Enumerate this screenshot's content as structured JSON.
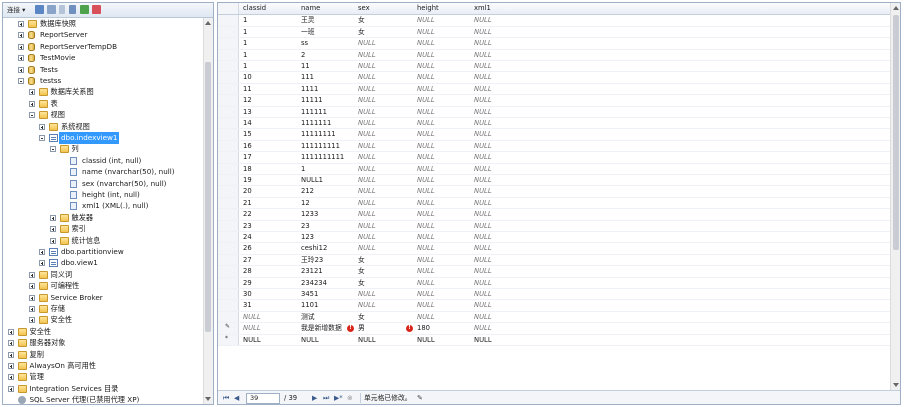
{
  "object_explorer": {
    "toolbar": {
      "connect_label": "连接 ▾"
    },
    "tree": [
      {
        "label": "数据库快照",
        "icon": "folder",
        "exp": "plus",
        "indent": 2
      },
      {
        "label": "ReportServer",
        "icon": "db",
        "exp": "plus",
        "indent": 2
      },
      {
        "label": "ReportServerTempDB",
        "icon": "db",
        "exp": "plus",
        "indent": 2
      },
      {
        "label": "TestMovie",
        "icon": "db",
        "exp": "plus",
        "indent": 2
      },
      {
        "label": "Tests",
        "icon": "db",
        "exp": "plus",
        "indent": 2
      },
      {
        "label": "testss",
        "icon": "db",
        "exp": "minus",
        "indent": 2
      },
      {
        "label": "数据库关系图",
        "icon": "folder",
        "exp": "plus",
        "indent": 3
      },
      {
        "label": "表",
        "icon": "folder",
        "exp": "plus",
        "indent": 3
      },
      {
        "label": "视图",
        "icon": "folder",
        "exp": "minus",
        "indent": 3
      },
      {
        "label": "系统视图",
        "icon": "folder",
        "exp": "plus",
        "indent": 4
      },
      {
        "label": "dbo.indexview1",
        "icon": "view",
        "exp": "minus",
        "indent": 4,
        "selected": true
      },
      {
        "label": "列",
        "icon": "folder",
        "exp": "minus",
        "indent": 5
      },
      {
        "label": "classid (int, null)",
        "icon": "col",
        "exp": "",
        "indent": 6
      },
      {
        "label": "name (nvarchar(50), null)",
        "icon": "col",
        "exp": "",
        "indent": 6
      },
      {
        "label": "sex (nvarchar(50), null)",
        "icon": "col",
        "exp": "",
        "indent": 6
      },
      {
        "label": "height (int, null)",
        "icon": "col",
        "exp": "",
        "indent": 6
      },
      {
        "label": "xml1 (XML(.), null)",
        "icon": "col",
        "exp": "",
        "indent": 6
      },
      {
        "label": "触发器",
        "icon": "folder",
        "exp": "plus",
        "indent": 5
      },
      {
        "label": "索引",
        "icon": "folder",
        "exp": "plus",
        "indent": 5
      },
      {
        "label": "统计信息",
        "icon": "folder",
        "exp": "plus",
        "indent": 5
      },
      {
        "label": "dbo.partitionview",
        "icon": "view",
        "exp": "plus",
        "indent": 4
      },
      {
        "label": "dbo.view1",
        "icon": "view",
        "exp": "plus",
        "indent": 4
      },
      {
        "label": "同义词",
        "icon": "folder",
        "exp": "plus",
        "indent": 3
      },
      {
        "label": "可编程性",
        "icon": "folder",
        "exp": "plus",
        "indent": 3
      },
      {
        "label": "Service Broker",
        "icon": "folder",
        "exp": "plus",
        "indent": 3
      },
      {
        "label": "存储",
        "icon": "folder",
        "exp": "plus",
        "indent": 3
      },
      {
        "label": "安全性",
        "icon": "folder",
        "exp": "plus",
        "indent": 3
      },
      {
        "label": "安全性",
        "icon": "folder",
        "exp": "plus",
        "indent": 1
      },
      {
        "label": "服务器对象",
        "icon": "folder",
        "exp": "plus",
        "indent": 1
      },
      {
        "label": "复制",
        "icon": "folder",
        "exp": "plus",
        "indent": 1
      },
      {
        "label": "AlwaysOn 高可用性",
        "icon": "folder",
        "exp": "plus",
        "indent": 1
      },
      {
        "label": "管理",
        "icon": "folder",
        "exp": "plus",
        "indent": 1
      },
      {
        "label": "Integration Services 目录",
        "icon": "folder",
        "exp": "plus",
        "indent": 1
      },
      {
        "label": "SQL Server 代理(已禁用代理 XP)",
        "icon": "gear",
        "exp": "",
        "indent": 1
      }
    ]
  },
  "grid": {
    "columns": [
      "classid",
      "name",
      "sex",
      "height",
      "xml1"
    ],
    "rows": [
      {
        "marker": "",
        "cells": [
          "1",
          "王灵",
          "女",
          "NULL",
          "NULL"
        ]
      },
      {
        "marker": "",
        "cells": [
          "1",
          "一班",
          "女",
          "NULL",
          "NULL"
        ]
      },
      {
        "marker": "",
        "cells": [
          "1",
          "ss",
          "NULL",
          "NULL",
          "NULL"
        ]
      },
      {
        "marker": "",
        "cells": [
          "1",
          "2",
          "NULL",
          "NULL",
          "NULL"
        ]
      },
      {
        "marker": "",
        "cells": [
          "1",
          "11",
          "NULL",
          "NULL",
          "NULL"
        ]
      },
      {
        "marker": "",
        "cells": [
          "10",
          "111",
          "NULL",
          "NULL",
          "NULL"
        ]
      },
      {
        "marker": "",
        "cells": [
          "11",
          "1111",
          "NULL",
          "NULL",
          "NULL"
        ]
      },
      {
        "marker": "",
        "cells": [
          "12",
          "11111",
          "NULL",
          "NULL",
          "NULL"
        ]
      },
      {
        "marker": "",
        "cells": [
          "13",
          "111111",
          "NULL",
          "NULL",
          "NULL"
        ]
      },
      {
        "marker": "",
        "cells": [
          "14",
          "1111111",
          "NULL",
          "NULL",
          "NULL"
        ]
      },
      {
        "marker": "",
        "cells": [
          "15",
          "11111111",
          "NULL",
          "NULL",
          "NULL"
        ]
      },
      {
        "marker": "",
        "cells": [
          "16",
          "111111111",
          "NULL",
          "NULL",
          "NULL"
        ]
      },
      {
        "marker": "",
        "cells": [
          "17",
          "1111111111",
          "NULL",
          "NULL",
          "NULL"
        ]
      },
      {
        "marker": "",
        "cells": [
          "18",
          "1",
          "NULL",
          "NULL",
          "NULL"
        ]
      },
      {
        "marker": "",
        "cells": [
          "19",
          "NULL1",
          "NULL",
          "NULL",
          "NULL"
        ]
      },
      {
        "marker": "",
        "cells": [
          "20",
          "212",
          "NULL",
          "NULL",
          "NULL"
        ]
      },
      {
        "marker": "",
        "cells": [
          "21",
          "12",
          "NULL",
          "NULL",
          "NULL"
        ]
      },
      {
        "marker": "",
        "cells": [
          "22",
          "1233",
          "NULL",
          "NULL",
          "NULL"
        ]
      },
      {
        "marker": "",
        "cells": [
          "23",
          "23",
          "NULL",
          "NULL",
          "NULL"
        ]
      },
      {
        "marker": "",
        "cells": [
          "24",
          "123",
          "NULL",
          "NULL",
          "NULL"
        ]
      },
      {
        "marker": "",
        "cells": [
          "26",
          "ceshi12",
          "NULL",
          "NULL",
          "NULL"
        ]
      },
      {
        "marker": "",
        "cells": [
          "27",
          "王玲23",
          "女",
          "NULL",
          "NULL"
        ]
      },
      {
        "marker": "",
        "cells": [
          "28",
          "23121",
          "女",
          "NULL",
          "NULL"
        ]
      },
      {
        "marker": "",
        "cells": [
          "29",
          "234234",
          "女",
          "NULL",
          "NULL"
        ]
      },
      {
        "marker": "",
        "cells": [
          "30",
          "3451",
          "NULL",
          "NULL",
          "NULL"
        ]
      },
      {
        "marker": "",
        "cells": [
          "31",
          "1101",
          "NULL",
          "NULL",
          "NULL"
        ]
      },
      {
        "marker": "",
        "cells": [
          "NULL",
          "测试",
          "女",
          "NULL",
          "NULL"
        ]
      },
      {
        "marker": "✎",
        "cells": [
          "NULL",
          "我是新增数据",
          "男",
          "180",
          "NULL"
        ],
        "errors": [
          1,
          2
        ]
      },
      {
        "marker": "*",
        "cells": [
          "NULL",
          "NULL",
          "NULL",
          "NULL",
          "NULL"
        ],
        "plain": true
      }
    ]
  },
  "navigator": {
    "current_record": "39",
    "total_records": "/ 39",
    "status": "单元格已修改。"
  }
}
